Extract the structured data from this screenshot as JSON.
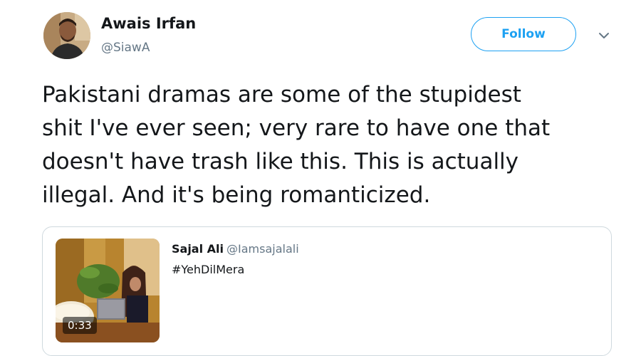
{
  "author": {
    "name": "Awais Irfan",
    "handle": "@SiawA"
  },
  "follow_button": {
    "label": "Follow"
  },
  "menu": {
    "icon": "chevron-down-icon"
  },
  "tweet": {
    "text": "Pakistani dramas are some of the stupidest\nshit I've ever seen; very rare to have one that\ndoesn't have trash like this. This is actually\nillegal. And it's being romanticized."
  },
  "quoted_tweet": {
    "name": "Sajal Ali",
    "handle": "@Iamsajalali",
    "text": "#YehDilMera",
    "video_duration": "0:33"
  },
  "colors": {
    "accent": "#1da1f2",
    "text": "#14171a",
    "secondary_text": "#657786",
    "border": "#cfd9de"
  }
}
